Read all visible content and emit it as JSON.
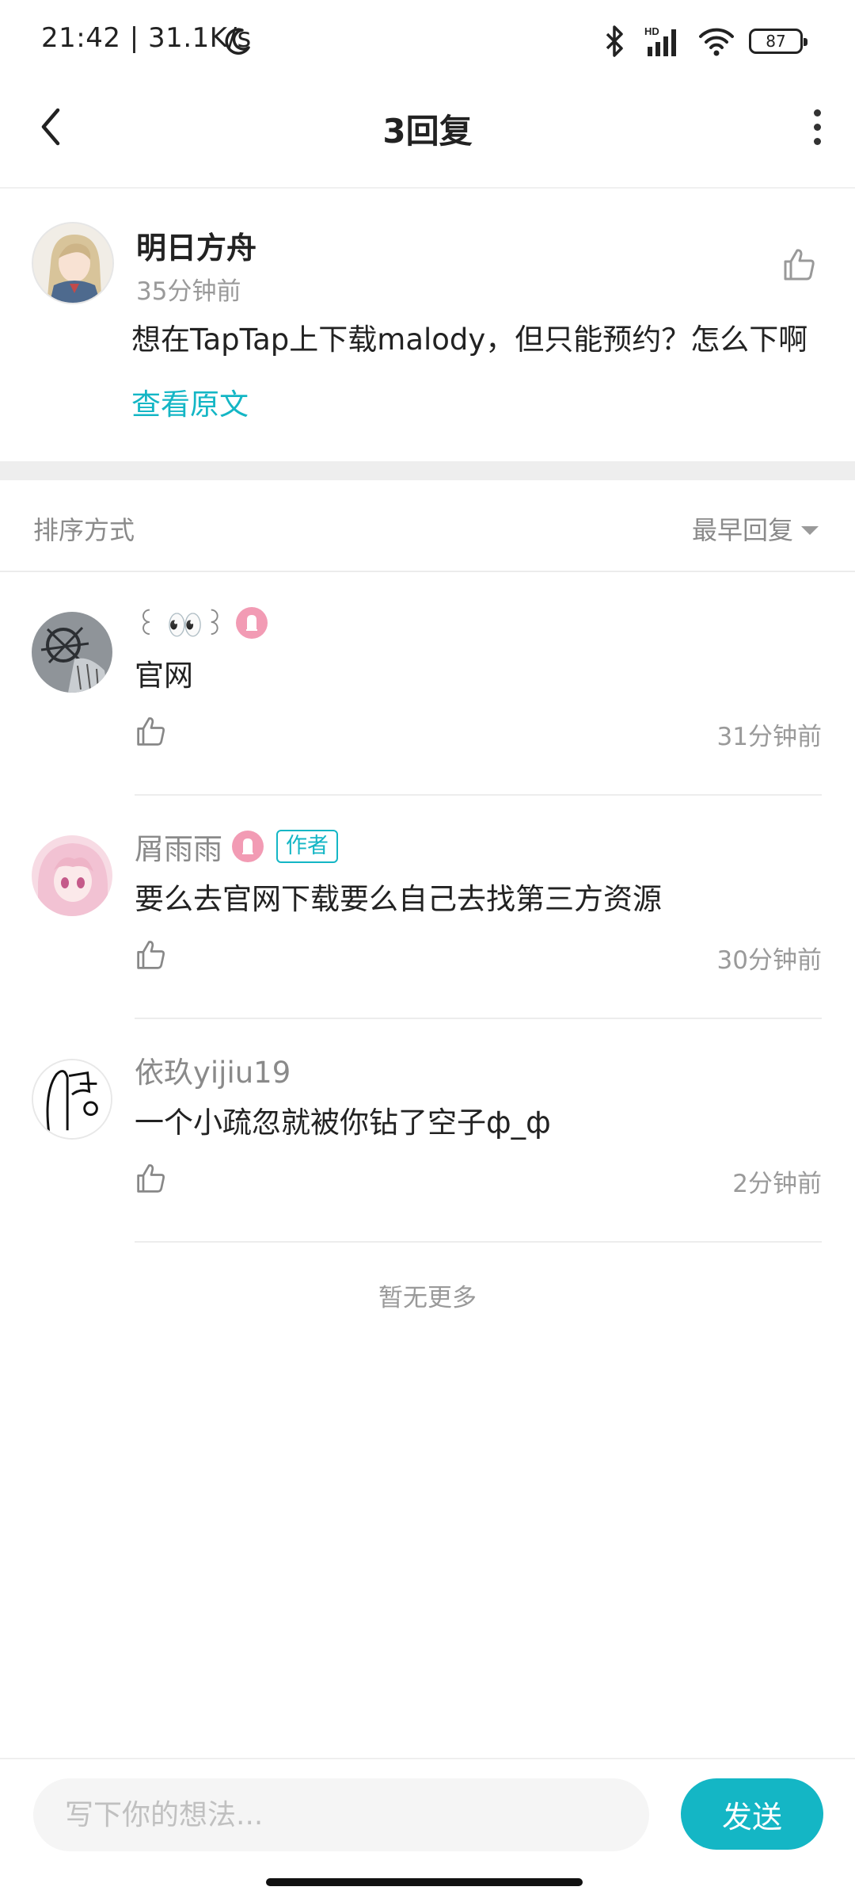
{
  "status_bar": {
    "time_speed": "21:42 | 31.1K/s",
    "signal_label": "HD",
    "battery": "87",
    "icons": [
      "moon-icon",
      "bluetooth-icon",
      "cell-signal-icon",
      "wifi-icon",
      "battery-icon"
    ]
  },
  "header": {
    "title": "3回复",
    "icons": [
      "back-arrow-icon",
      "more-vertical-icon"
    ]
  },
  "original_post": {
    "author": "明日方舟",
    "time": "35分钟前",
    "content": "想在TapTap上下载malody，但只能预约？怎么下啊",
    "view_original": "查看原文"
  },
  "sort": {
    "label": "排序方式",
    "value": "最早回复"
  },
  "replies": [
    {
      "name": "꒰ 👀꒱",
      "has_badge": true,
      "author_tag": "",
      "content": "官网",
      "time": "31分钟前"
    },
    {
      "name": "屑雨雨",
      "has_badge": true,
      "author_tag": "作者",
      "content": "要么去官网下载要么自己去找第三方资源",
      "time": "30分钟前"
    },
    {
      "name": "依玖yijiu19",
      "has_badge": false,
      "author_tag": "",
      "content": "一个小疏忽就被你钻了空子ф_ф",
      "time": "2分钟前"
    }
  ],
  "footer_note": "暂无更多",
  "composer": {
    "placeholder": "写下你的想法...",
    "send_label": "发送"
  },
  "colors": {
    "accent": "#14b6c5",
    "badge_pink": "#f29bb4",
    "secondary_text": "#9a9a9a"
  }
}
